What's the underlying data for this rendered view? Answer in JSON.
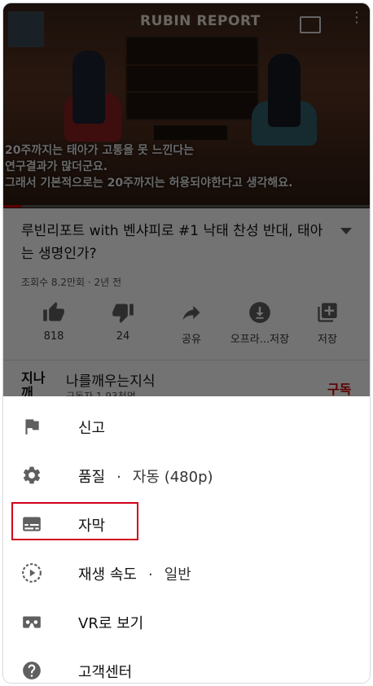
{
  "video": {
    "brand": "RUBIN REPORT",
    "caption_lines": [
      "20주까지는 태아가 고통을 못 느낀다는",
      "연구결과가 많더군요.",
      "그래서 기본적으로는 20주까지는 허용되야한다고 생각해요."
    ],
    "progress_fraction": 0.05
  },
  "info": {
    "title": "루빈리포트 with 벤샤피로 #1 낙태 찬성 반대, 태아는 생명인가?",
    "meta": "조회수 8.2만회 · 2년 전",
    "actions": [
      {
        "icon": "thumb-up-icon",
        "label": "818"
      },
      {
        "icon": "thumb-down-icon",
        "label": "24"
      },
      {
        "icon": "share-icon",
        "label": "공유"
      },
      {
        "icon": "download-icon",
        "label": "오프라...저장"
      },
      {
        "icon": "add-to-playlist-icon",
        "label": "저장"
      }
    ]
  },
  "channel": {
    "avatar_text": "지나깨",
    "name": "나를깨우는지식",
    "subs": "구독자 1.93천명",
    "subscribe_label": "구독"
  },
  "menu": {
    "items": [
      {
        "icon": "flag-icon",
        "label": "신고",
        "value": ""
      },
      {
        "icon": "gear-icon",
        "label": "품질",
        "value": "자동 (480p)"
      },
      {
        "icon": "captions-icon",
        "label": "자막",
        "value": ""
      },
      {
        "icon": "playback-speed-icon",
        "label": "재생 속도",
        "value": "일반"
      },
      {
        "icon": "vr-headset-icon",
        "label": "VR로 보기",
        "value": ""
      },
      {
        "icon": "help-icon",
        "label": "고객센터",
        "value": ""
      }
    ],
    "separator": "·",
    "highlighted_index": 2,
    "highlight_color": "#d0021b"
  },
  "colors": {
    "accent": "#cc0000",
    "icon": "#5f5f5f"
  }
}
